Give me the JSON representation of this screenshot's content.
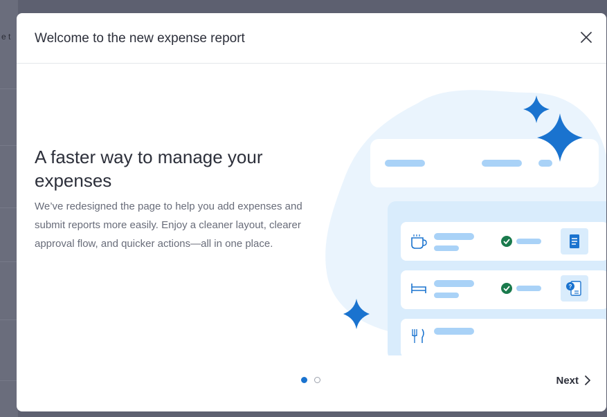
{
  "modal": {
    "title": "Welcome to the new expense report",
    "headline": "A faster way to manage your expenses",
    "description": "We’ve redesigned the page to help you add expenses and submit reports more easily. Enjoy a cleaner layout, clearer approval flow, and quicker actions—all in one place.",
    "next_label": "Next",
    "pager": {
      "total": 2,
      "current": 1
    }
  },
  "background": {
    "peek_text": "e t"
  },
  "colors": {
    "accent": "#1a73cf",
    "light_blue": "#eaf4fd",
    "bar_blue": "#a9d2f7",
    "check_green": "#1a7a4c"
  },
  "icons": [
    "close-icon",
    "coffee-icon",
    "bed-icon",
    "fork-knife-icon",
    "receipt-icon",
    "receipt-question-icon",
    "checkmark-icon",
    "chevron-right-icon",
    "sparkle-icon"
  ]
}
